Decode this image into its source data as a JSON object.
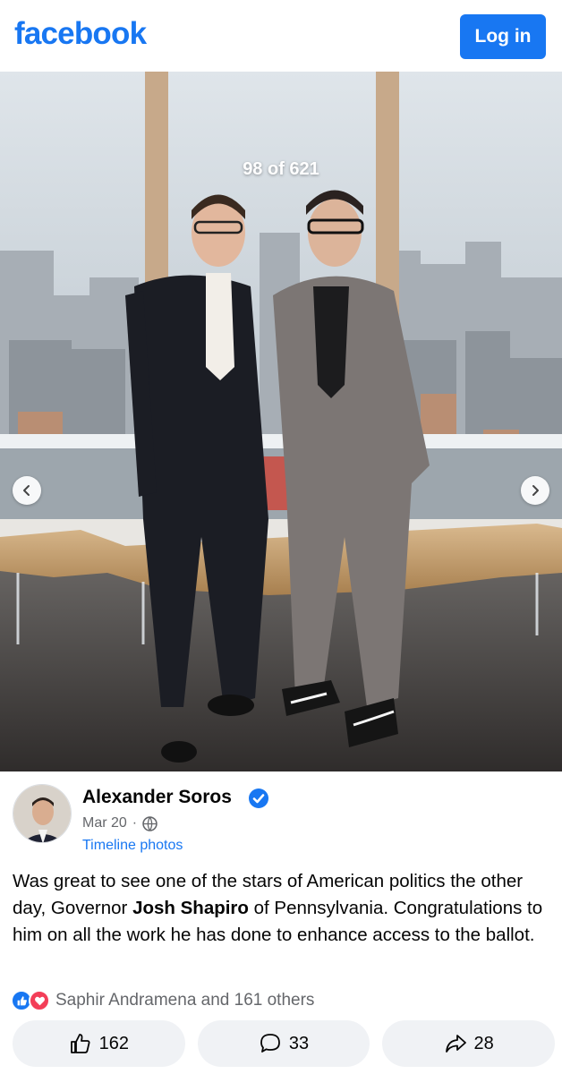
{
  "header": {
    "logo_text": "facebook",
    "login_label": "Log in",
    "brand_color": "#1877f2"
  },
  "viewer": {
    "counter": "98 of 621",
    "prev_icon": "chevron-left-icon",
    "next_icon": "chevron-right-icon"
  },
  "post": {
    "author": "Alexander Soros",
    "verified_icon": "verified-badge-icon",
    "date": "Mar 20",
    "separator": "·",
    "audience_icon": "globe-icon",
    "album": "Timeline photos",
    "text_parts": [
      "Was great to see one of the stars of American politics the other day, Governor ",
      "Josh Shapiro",
      " of Pennsylvania. Congratulations to him on all the work he has done to enhance access to the ballot."
    ]
  },
  "reactions": {
    "icons": [
      "like-reaction-icon",
      "love-reaction-icon"
    ],
    "summary": "Saphir Andramena and 161 others"
  },
  "actions": {
    "like_count": "162",
    "comment_count": "33",
    "share_count": "28"
  }
}
